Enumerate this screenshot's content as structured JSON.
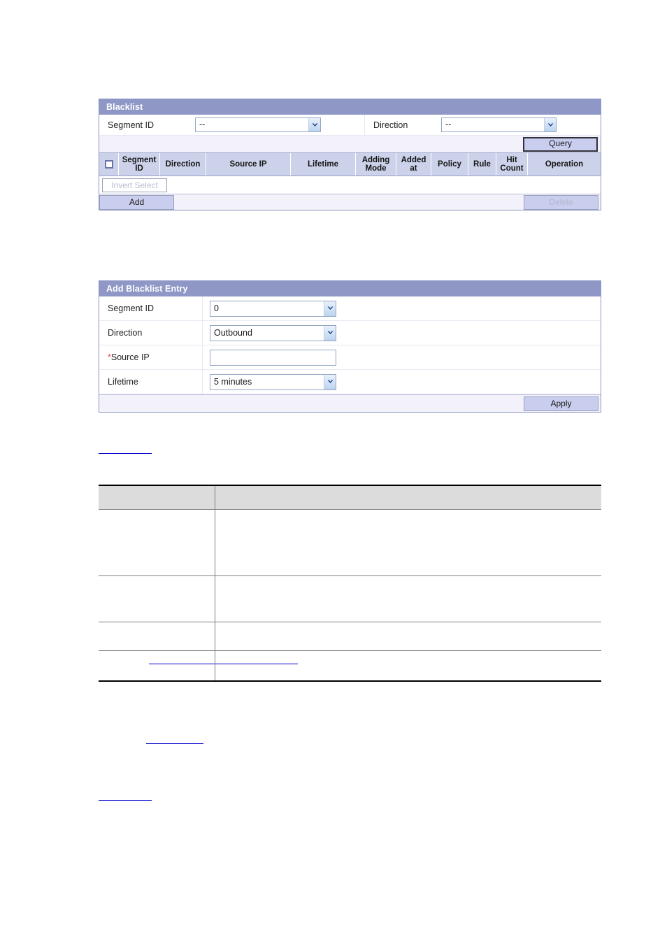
{
  "blacklist_panel": {
    "title": "Blacklist",
    "query_form": {
      "segment_id_label": "Segment ID",
      "segment_id_value": "--",
      "direction_label": "Direction",
      "direction_value": "--",
      "query_button": "Query"
    },
    "grid": {
      "columns": [
        "Segment ID",
        "Direction",
        "Source IP",
        "Lifetime",
        "Adding Mode",
        "Added at",
        "Policy",
        "Rule",
        "Hit Count",
        "Operation"
      ],
      "rows": []
    },
    "invert_select_button": "Invert Select",
    "add_button": "Add",
    "delete_button": "Delete"
  },
  "add_entry_panel": {
    "title": "Add Blacklist Entry",
    "fields": [
      {
        "label": "Segment ID",
        "value": "0",
        "type": "select"
      },
      {
        "label": "Direction",
        "value": "Outbound",
        "type": "select"
      },
      {
        "label": "Source IP",
        "value": "",
        "type": "text",
        "required": true,
        "star": "*"
      },
      {
        "label": "Lifetime",
        "value": "5 minutes",
        "type": "select"
      }
    ],
    "apply_button": "Apply"
  },
  "description_table": {
    "header": [
      "",
      ""
    ],
    "rows": [
      [
        "",
        ""
      ],
      [
        "",
        ""
      ],
      [
        "",
        ""
      ],
      [
        "",
        ""
      ]
    ]
  },
  "links": [
    {
      "text": ""
    },
    {
      "text": ""
    },
    {
      "text": ""
    },
    {
      "text": ""
    }
  ],
  "colors": {
    "panel_title_bg": "#8e97c6",
    "panel_border": "#8b94c4",
    "grid_header_bg": "#ccd2ea",
    "button_bg": "#c9cdee",
    "footer_bg": "#f3f1fa",
    "link": "#0000cc",
    "required_star": "#e8405a",
    "doc_header_bg": "#dcdcdc"
  }
}
